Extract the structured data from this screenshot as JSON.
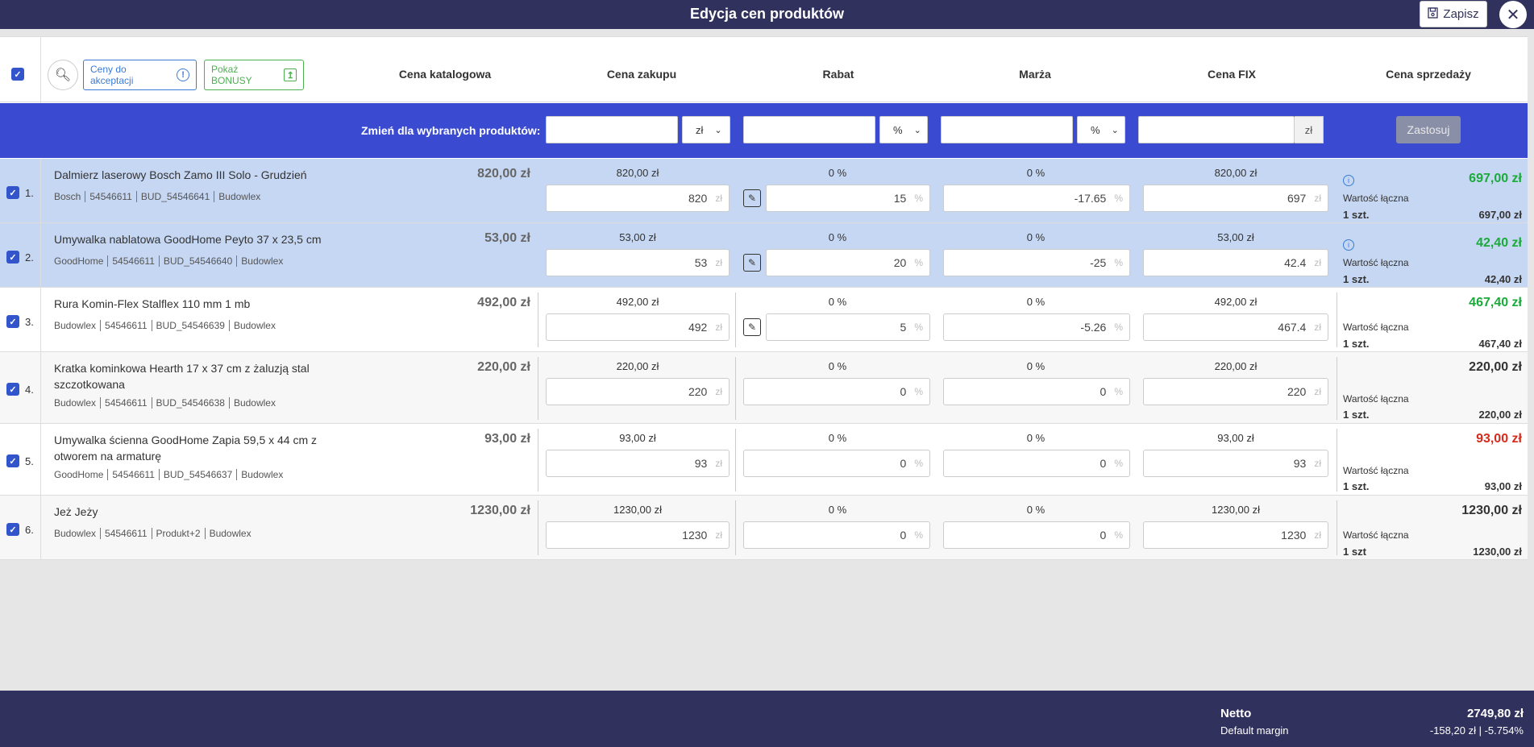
{
  "window": {
    "title": "Edycja cen produktów",
    "save_label": "Zapisz"
  },
  "toolbar": {
    "accept_label": "Ceny do akceptacji",
    "bonus_label": "Pokaż BONUSY"
  },
  "columns": [
    "Cena katalogowa",
    "Cena zakupu",
    "Rabat",
    "Marża",
    "Cena FIX",
    "Cena sprzedaży"
  ],
  "bulk": {
    "label": "Zmień dla wybranych produktów:",
    "purchase_unit": "zł",
    "discount_unit": "%",
    "margin_unit": "%",
    "fix_unit": "zł",
    "apply_label": "Zastosuj"
  },
  "common": {
    "total_label": "Wartość łączna"
  },
  "colors": {
    "selected_row": "#c6d7f3",
    "header": "#30315c",
    "bulk": "#3a4bd1",
    "green": "#1aaa3a",
    "red": "#d62a1a"
  },
  "rows": [
    {
      "num": "1.",
      "name": "Dalmierz laserowy Bosch Zamo III Solo - Grudzień",
      "tags": [
        "Bosch",
        "54546611",
        "BUD_54546641",
        "Budowlex"
      ],
      "catalog_price": "820,00 zł",
      "purchase_text": "820,00 zł",
      "purchase_input": "820",
      "discount_text": "0 %",
      "discount_input": "15",
      "margin_text": "0 %",
      "margin_input": "-17.65",
      "fix_text": "820,00 zł",
      "fix_input": "697",
      "sale_price": "697,00 zł",
      "qty": "1 szt.",
      "total": "697,00 zł",
      "unit_zl": "zł",
      "unit_pct": "%"
    },
    {
      "num": "2.",
      "name": "Umywalka nablatowa GoodHome Peyto 37 x 23,5 cm",
      "tags": [
        "GoodHome",
        "54546611",
        "BUD_54546640",
        "Budowlex"
      ],
      "catalog_price": "53,00 zł",
      "purchase_text": "53,00 zł",
      "purchase_input": "53",
      "discount_text": "0 %",
      "discount_input": "20",
      "margin_text": "0 %",
      "margin_input": "-25",
      "fix_text": "53,00 zł",
      "fix_input": "42.4",
      "sale_price": "42,40 zł",
      "qty": "1 szt.",
      "total": "42,40 zł",
      "unit_zl": "zł",
      "unit_pct": "%"
    },
    {
      "num": "3.",
      "name": "Rura Komin-Flex Stalflex 110 mm 1 mb",
      "tags": [
        "Budowlex",
        "54546611",
        "BUD_54546639",
        "Budowlex"
      ],
      "catalog_price": "492,00 zł",
      "purchase_text": "492,00 zł",
      "purchase_input": "492",
      "discount_text": "0 %",
      "discount_input": "5",
      "margin_text": "0 %",
      "margin_input": "-5.26",
      "fix_text": "492,00 zł",
      "fix_input": "467.4",
      "sale_price": "467,40 zł",
      "qty": "1 szt.",
      "total": "467,40 zł",
      "unit_zl": "zł",
      "unit_pct": "%"
    },
    {
      "num": "4.",
      "name": "Kratka kominkowa Hearth 17 x 37 cm z żaluzją stal szczotkowana",
      "tags": [
        "Budowlex",
        "54546611",
        "BUD_54546638",
        "Budowlex"
      ],
      "catalog_price": "220,00 zł",
      "purchase_text": "220,00 zł",
      "purchase_input": "220",
      "discount_text": "0 %",
      "discount_input": "0",
      "margin_text": "0 %",
      "margin_input": "0",
      "fix_text": "220,00 zł",
      "fix_input": "220",
      "sale_price": "220,00 zł",
      "qty": "1 szt.",
      "total": "220,00 zł",
      "unit_zl": "zł",
      "unit_pct": "%"
    },
    {
      "num": "5.",
      "name": "Umywalka ścienna GoodHome Zapia 59,5 x 44 cm z otworem na armaturę",
      "tags": [
        "GoodHome",
        "54546611",
        "BUD_54546637",
        "Budowlex"
      ],
      "catalog_price": "93,00 zł",
      "purchase_text": "93,00 zł",
      "purchase_input": "93",
      "discount_text": "0 %",
      "discount_input": "0",
      "margin_text": "0 %",
      "margin_input": "0",
      "fix_text": "93,00 zł",
      "fix_input": "93",
      "sale_price": "93,00 zł",
      "qty": "1 szt.",
      "total": "93,00 zł",
      "unit_zl": "zł",
      "unit_pct": "%"
    },
    {
      "num": "6.",
      "name": "Jeż Jeży",
      "tags": [
        "Budowlex",
        "54546611",
        "Produkt+2",
        "Budowlex"
      ],
      "catalog_price": "1230,00 zł",
      "purchase_text": "1230,00 zł",
      "purchase_input": "1230",
      "discount_text": "0 %",
      "discount_input": "0",
      "margin_text": "0 %",
      "margin_input": "0",
      "fix_text": "1230,00 zł",
      "fix_input": "1230",
      "sale_price": "1230,00 zł",
      "qty": "1 szt",
      "total": "1230,00 zł",
      "unit_zl": "zł",
      "unit_pct": "%"
    }
  ],
  "footer": {
    "net_label": "Netto",
    "net_value": "2749,80 zł",
    "margin_label": "Default margin",
    "margin_value": "-158,20 zł | -5.754%"
  }
}
